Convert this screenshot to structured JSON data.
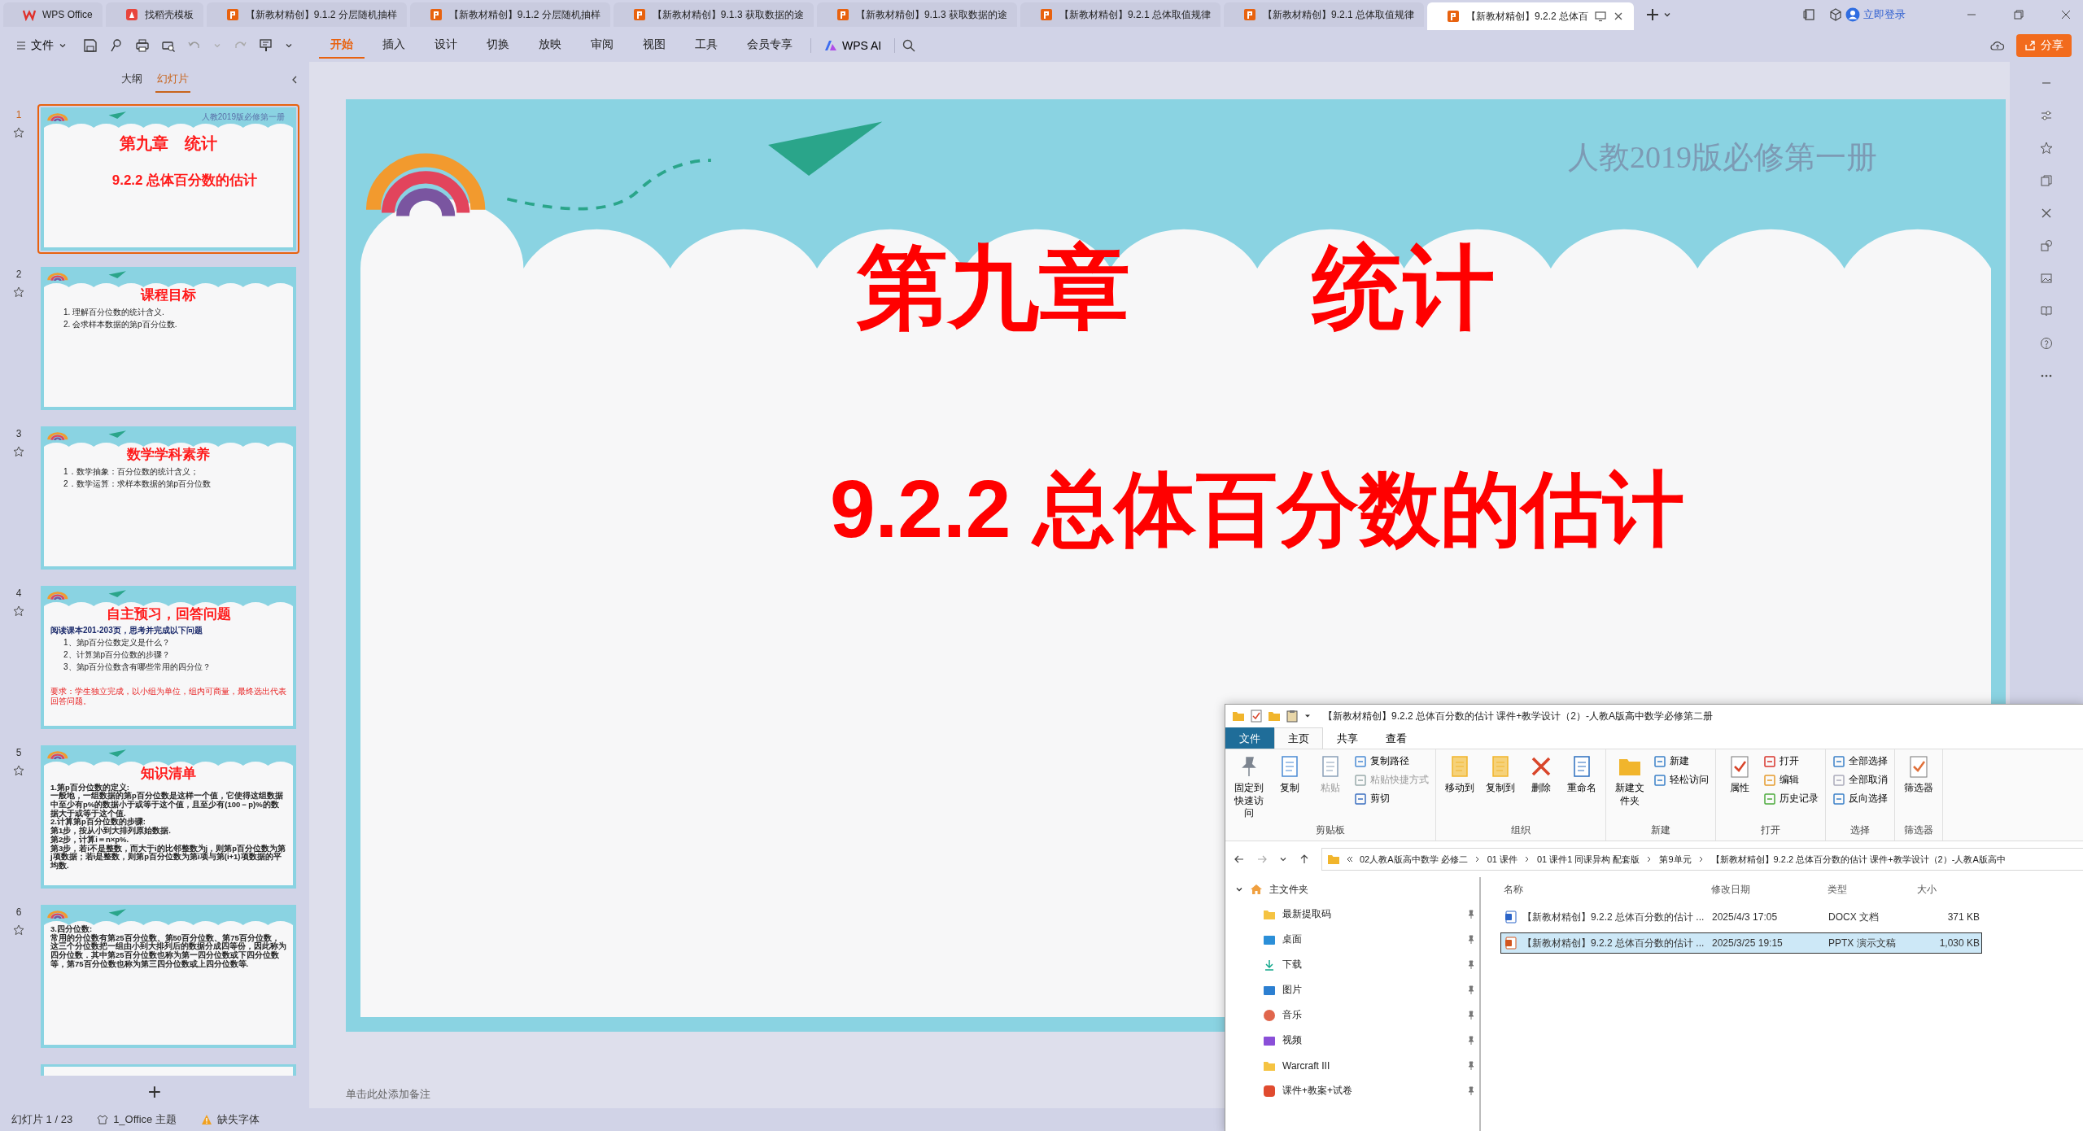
{
  "app_tabs": [
    {
      "label": "WPS Office",
      "kind": "home",
      "selected": false
    },
    {
      "label": "找稻壳模板",
      "kind": "template",
      "selected": false
    },
    {
      "label": "【新教材精创】9.1.2 分层随机抽样",
      "kind": "presentation",
      "selected": false
    },
    {
      "label": "【新教材精创】9.1.2 分层随机抽样",
      "kind": "presentation",
      "selected": false
    },
    {
      "label": "【新教材精创】9.1.3 获取数据的途",
      "kind": "presentation",
      "selected": false
    },
    {
      "label": "【新教材精创】9.1.3 获取数据的途",
      "kind": "presentation",
      "selected": false
    },
    {
      "label": "【新教材精创】9.2.1 总体取值规律",
      "kind": "presentation",
      "selected": false
    },
    {
      "label": "【新教材精创】9.2.1 总体取值规律",
      "kind": "presentation",
      "selected": false
    },
    {
      "label": "【新教材精创】9.2.2 总体百",
      "kind": "presentation",
      "selected": true
    }
  ],
  "login": "立即登录",
  "file_menu": "文件",
  "ribbon_tabs": [
    {
      "label": "开始",
      "selected": true
    },
    {
      "label": "插入",
      "selected": false
    },
    {
      "label": "设计",
      "selected": false
    },
    {
      "label": "切换",
      "selected": false
    },
    {
      "label": "放映",
      "selected": false
    },
    {
      "label": "审阅",
      "selected": false
    },
    {
      "label": "视图",
      "selected": false
    },
    {
      "label": "工具",
      "selected": false
    },
    {
      "label": "会员专享",
      "selected": false
    }
  ],
  "ai_label": "WPS AI",
  "share": "分享",
  "panel_tabs": [
    {
      "label": "大纲",
      "selected": false
    },
    {
      "label": "幻灯片",
      "selected": true
    }
  ],
  "thumbnails": [
    {
      "number": "1",
      "selected": true,
      "header": "人教2019版必修第一册",
      "title": "第九章　统计",
      "subtitle": "9.2.2 总体百分数的估计"
    },
    {
      "number": "2",
      "selected": false,
      "title": "课程目标",
      "lines": [
        {
          "text": "1. 理解百分位数的统计含义.",
          "kind": "item"
        },
        {
          "text": "2. 会求样本数据的第p百分位数.",
          "kind": "item"
        }
      ]
    },
    {
      "number": "3",
      "selected": false,
      "title": "数学学科素养",
      "lines": [
        {
          "text": "1．数学抽象：百分位数的统计含义；",
          "kind": "item"
        },
        {
          "text": "2．数学运算：求样本数据的第p百分位数",
          "kind": "item"
        }
      ]
    },
    {
      "number": "4",
      "selected": false,
      "title": "自主预习，回答问题",
      "lines": [
        {
          "text": "阅读课本201-203页，思考并完成以下问题",
          "kind": "intro"
        },
        {
          "text": "1、第p百分位数定义是什么？",
          "kind": "item"
        },
        {
          "text": "2、计算第p百分位数的步骤？",
          "kind": "item"
        },
        {
          "text": "3、第p百分位数含有哪些常用的四分位？",
          "kind": "item"
        },
        {
          "text": "要求：学生独立完成，以小组为单位，组内可商量，最终选出代表回答问题。",
          "kind": "note"
        }
      ]
    },
    {
      "number": "5",
      "selected": false,
      "title": "知识清单",
      "lines": [
        {
          "text": "1.第p百分位数的定义:",
          "kind": "para"
        },
        {
          "text": "一般地，一组数据的第p百分位数是这样一个值，它使得这组数据中至少有p%的数据小于或等于这个值，且至少有(100－p)%的数据大于或等于这个值.",
          "kind": "para"
        },
        {
          "text": "2.计算第p百分位数的步骤:",
          "kind": "para"
        },
        {
          "text": "第1步，按从小到大排列原始数据.",
          "kind": "para"
        },
        {
          "text": "第2步，计算i＝n×p%.",
          "kind": "para"
        },
        {
          "text": "第3步，若i不是整数，而大于i的比邻整数为j，则第p百分位数为第j项数据；若i是整数，则第p百分位数为第i项与第(i+1)项数据的平均数.",
          "kind": "para"
        }
      ]
    },
    {
      "number": "6",
      "selected": false,
      "lines": [
        {
          "text": "3.四分位数:",
          "kind": "para"
        },
        {
          "text": "常用的分位数有第25百分位数、第50百分位数、第75百分位数，这三个分位数把一组由小到大排列后的数据分成四等份，因此称为四分位数．其中第25百分位数也称为第一四分位数或下四分位数等，第75百分位数也称为第三四分位数或上四分位数等.",
          "kind": "para"
        }
      ]
    },
    {
      "selected": false
    }
  ],
  "add_slide": "+",
  "main_slide": {
    "header": "人教2019版必修第一册",
    "title": "第九章　　统计",
    "subtitle": "9.2.2 总体百分数的估计"
  },
  "notes_placeholder": "单击此处添加备注",
  "status_bar": {
    "slide_counter": "幻灯片 1 / 23",
    "theme": "1_Office 主题",
    "warning": "缺失字体"
  },
  "explorer": {
    "title": "【新教材精创】9.2.2 总体百分数的估计 课件+教学设计（2）-人教A版高中数学必修第二册",
    "tabs": [
      {
        "label": "文件",
        "kind": "file",
        "selected": false
      },
      {
        "label": "主页",
        "kind": "tab",
        "selected": true
      },
      {
        "label": "共享",
        "kind": "tab",
        "selected": false
      },
      {
        "label": "查看",
        "kind": "tab",
        "selected": false
      }
    ],
    "groups": [
      {
        "name": "剪贴板",
        "large": [
          {
            "label": "固定到快速访问",
            "kind": "pin",
            "disabled": false
          },
          {
            "label": "复制",
            "kind": "copy",
            "disabled": false
          },
          {
            "label": "粘贴",
            "kind": "paste",
            "disabled": true
          }
        ],
        "small": [
          {
            "label": "复制路径",
            "kind": "path",
            "disabled": false
          },
          {
            "label": "粘贴快捷方式",
            "kind": "shortcut",
            "disabled": true
          },
          {
            "label": "剪切",
            "kind": "cut",
            "disabled": false
          }
        ]
      },
      {
        "name": "组织",
        "large": [
          {
            "label": "移动到",
            "kind": "move",
            "disabled": false
          },
          {
            "label": "复制到",
            "kind": "copyto",
            "disabled": false
          },
          {
            "label": "删除",
            "kind": "delete",
            "disabled": false
          },
          {
            "label": "重命名",
            "kind": "rename",
            "disabled": false
          }
        ]
      },
      {
        "name": "新建",
        "large": [
          {
            "label": "新建文件夹",
            "kind": "folder",
            "disabled": false
          }
        ],
        "small": [
          {
            "label": "新建",
            "kind": "new",
            "disabled": false
          },
          {
            "label": "轻松访问",
            "kind": "access",
            "disabled": false
          }
        ]
      },
      {
        "name": "打开",
        "large": [
          {
            "label": "属性",
            "kind": "properties",
            "disabled": false
          }
        ],
        "small": [
          {
            "label": "打开",
            "kind": "open",
            "disabled": false
          },
          {
            "label": "编辑",
            "kind": "edit",
            "disabled": false
          },
          {
            "label": "历史记录",
            "kind": "history",
            "disabled": false
          }
        ]
      },
      {
        "name": "选择",
        "small": [
          {
            "label": "全部选择",
            "kind": "selectall",
            "disabled": false
          },
          {
            "label": "全部取消",
            "kind": "selectnone",
            "disabled": false
          },
          {
            "label": "反向选择",
            "kind": "invert",
            "disabled": false
          }
        ]
      },
      {
        "name": "筛选器",
        "large": [
          {
            "label": "筛选器",
            "kind": "filter",
            "disabled": false
          }
        ]
      }
    ],
    "path": [
      "02人教A版高中数学 必修二",
      "01 课件",
      "01 课件1 同课异构 配套版",
      "第9单元",
      "【新教材精创】9.2.2 总体百分数的估计 课件+教学设计（2）-人教A版高中"
    ],
    "nav_root": {
      "label": "主文件夹",
      "expanded": true,
      "children": [
        {
          "label": "最新提取码",
          "kind": "folder"
        },
        {
          "label": "桌面",
          "kind": "desktop"
        },
        {
          "label": "下载",
          "kind": "download"
        },
        {
          "label": "图片",
          "kind": "pictures"
        },
        {
          "label": "音乐",
          "kind": "music"
        },
        {
          "label": "视频",
          "kind": "videos"
        },
        {
          "label": "Warcraft III",
          "kind": "folder"
        },
        {
          "label": "课件+教案+试卷",
          "kind": "app"
        }
      ]
    },
    "columns": [
      "名称",
      "修改日期",
      "类型",
      "大小"
    ],
    "files": [
      {
        "name": "【新教材精创】9.2.2 总体百分数的估计 ...",
        "date": "2025/4/3 17:05",
        "type": "DOCX 文档",
        "size": "371 KB",
        "kind": "document",
        "selected": false
      },
      {
        "name": "【新教材精创】9.2.2 总体百分数的估计 ...",
        "date": "2025/3/25 19:15",
        "type": "PPTX 演示文稿",
        "size": "1,030 KB",
        "kind": "presentation",
        "selected": true
      }
    ]
  }
}
